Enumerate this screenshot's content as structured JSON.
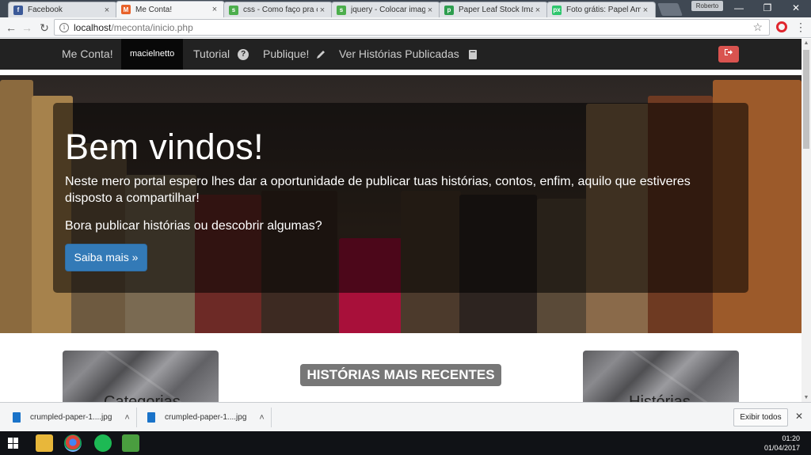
{
  "browser": {
    "tabs": [
      {
        "label": "Facebook",
        "favicon": "facebook-icon",
        "color": "#3b5998",
        "glyph": "f"
      },
      {
        "label": "Me Conta!",
        "favicon": "meconta-icon",
        "color": "#e8622a",
        "glyph": "M"
      },
      {
        "label": "css - Como faço pra co",
        "favicon": "stackoverflow-icon",
        "color": "#4cae4c",
        "glyph": "s"
      },
      {
        "label": "jquery - Colocar image",
        "favicon": "stackoverflow-icon",
        "color": "#4cae4c",
        "glyph": "s"
      },
      {
        "label": "Paper Leaf Stock Image",
        "favicon": "stockimage-icon",
        "color": "#2e9e4f",
        "glyph": "p"
      },
      {
        "label": "Foto grátis: Papel Ama",
        "favicon": "pixabay-icon",
        "color": "#2ec66d",
        "glyph": "px"
      }
    ],
    "profile_name": "Roberto",
    "url_host": "localhost",
    "url_path": "/meconta/inicio.php"
  },
  "site": {
    "brand": "Me Conta!",
    "user": "macielnetto",
    "nav": {
      "tutorial": "Tutorial",
      "publique": "Publique!",
      "historias": "Ver Histórias Publicadas"
    },
    "logout_icon": "sign-out-icon"
  },
  "hero": {
    "title": "Bem vindos!",
    "lead": "Neste mero portal espero lhes dar a oportunidade de publicar tuas histórias, contos, enfim, aquilo que estiveres disposto a compartilhar!",
    "cta_text": "Bora publicar histórias ou descobrir algumas?",
    "button": "Saiba mais »"
  },
  "sections": {
    "left_card": "Categorias",
    "center_badge": "HISTÓRIAS MAIS RECENTES",
    "right_card": "Histórias"
  },
  "downloads": {
    "items": [
      {
        "name": "crumpled-paper-1....jpg"
      },
      {
        "name": "crumpled-paper-1....jpg"
      }
    ],
    "show_all": "Exibir todos"
  },
  "taskbar": {
    "time": "01:20",
    "date": "01/04/2017"
  }
}
